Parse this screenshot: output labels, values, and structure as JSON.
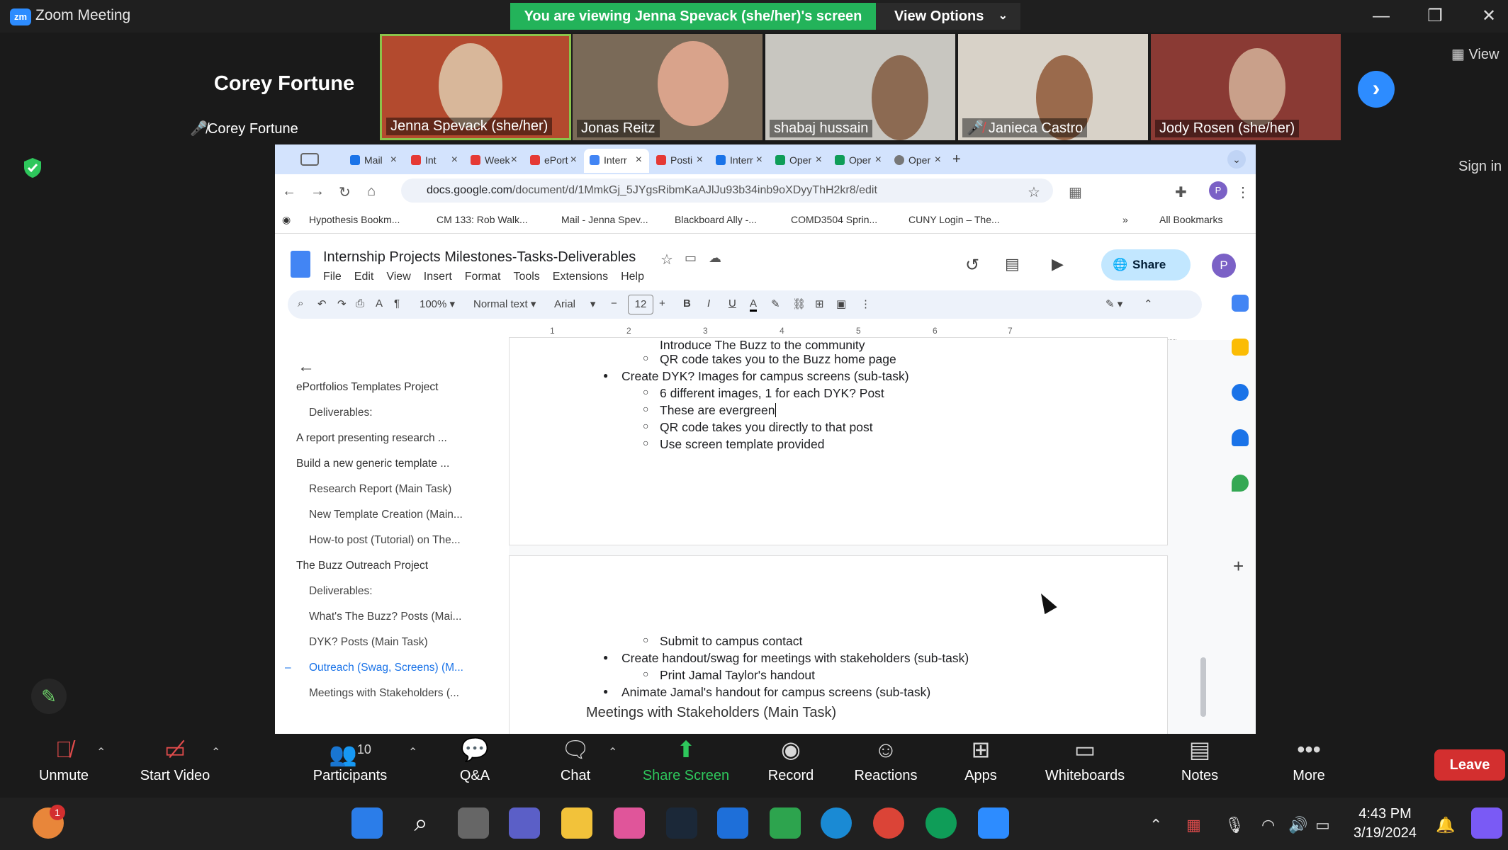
{
  "window": {
    "title": "Zoom Meeting",
    "logo": "zm"
  },
  "banner": {
    "viewing": "You are viewing Jenna Spevack (she/her)'s screen",
    "view_options": "View Options"
  },
  "gallery": {
    "active_speaker": "Corey Fortune",
    "tiles": [
      {
        "name": "Corey Fortune",
        "muted": true
      },
      {
        "name": "Jenna Spevack (she/her)",
        "muted": false
      },
      {
        "name": "Jonas Reitz",
        "muted": false
      },
      {
        "name": "shabaj hussain",
        "muted": false
      },
      {
        "name": "Janieca Castro",
        "muted": true
      },
      {
        "name": "Jody Rosen (she/her)",
        "muted": false
      }
    ],
    "view_label": "View"
  },
  "signin": "Sign in",
  "browser": {
    "tabs": [
      "Mail",
      "Int",
      "Week",
      "ePort",
      "Interr",
      "Posti",
      "Interr",
      "Oper",
      "Oper",
      "Oper"
    ],
    "url_domain": "docs.google.com",
    "url_path": "/document/d/1MmkGj_5JYgsRibmKaAJlJu93b34inb9oXDyyThH2kr8/edit",
    "bookmarks": [
      "Hypothesis Bookm...",
      "CM 133: Rob Walk...",
      "Mail - Jenna Spev...",
      "Blackboard Ally -...",
      "COMD3504 Sprin...",
      "CUNY Login – The...",
      "All Bookmarks"
    ]
  },
  "doc": {
    "title": "Internship Projects Milestones-Tasks-Deliverables",
    "menu": [
      "File",
      "Edit",
      "View",
      "Insert",
      "Format",
      "Tools",
      "Extensions",
      "Help"
    ],
    "share": "Share",
    "avatar": "P",
    "toolbar": {
      "zoom": "100%",
      "style": "Normal text",
      "font": "Arial",
      "size": "12"
    },
    "ruler": [
      "1",
      "2",
      "3",
      "4",
      "5",
      "6",
      "7"
    ],
    "outline": [
      {
        "text": "ePortfolios Templates Project",
        "level": 1
      },
      {
        "text": "Deliverables:",
        "level": 2
      },
      {
        "text": "A report presenting research ...",
        "level": 1
      },
      {
        "text": "Build a new generic template ...",
        "level": 1
      },
      {
        "text": "Research Report (Main Task)",
        "level": 2
      },
      {
        "text": "New Template Creation (Main...",
        "level": 2
      },
      {
        "text": "How-to post (Tutorial) on The...",
        "level": 2
      },
      {
        "text": "The Buzz Outreach Project",
        "level": 1
      },
      {
        "text": "Deliverables:",
        "level": 2
      },
      {
        "text": "What's The Buzz? Posts (Mai...",
        "level": 2
      },
      {
        "text": "DYK? Posts (Main Task)",
        "level": 2
      },
      {
        "text": "Outreach (Swag, Screens) (M...",
        "level": 2,
        "active": true
      },
      {
        "text": "Meetings with Stakeholders (...",
        "level": 2
      }
    ],
    "page1": [
      {
        "t": "Introduce The Buzz to the community",
        "lvl": 2
      },
      {
        "t": "QR code takes you to the Buzz home page",
        "lvl": 2
      },
      {
        "t": "Create DYK? Images for campus screens (sub-task)",
        "lvl": 1
      },
      {
        "t": "6 different images, 1 for each DYK? Post",
        "lvl": 2
      },
      {
        "t": "These are evergreen",
        "lvl": 2
      },
      {
        "t": "QR code takes you directly to that post",
        "lvl": 2
      },
      {
        "t": "Use screen template provided",
        "lvl": 2
      }
    ],
    "page2": [
      {
        "t": "Submit to campus contact",
        "lvl": 2
      },
      {
        "t": "Create handout/swag for meetings with stakeholders (sub-task)",
        "lvl": 1
      },
      {
        "t": "Print Jamal Taylor's handout",
        "lvl": 2
      },
      {
        "t": "Animate Jamal's handout for campus screens (sub-task)",
        "lvl": 1
      }
    ],
    "heading": "Meetings with Stakeholders (Main Task)"
  },
  "zoombar": {
    "unmute": "Unmute",
    "video": "Start Video",
    "participants": "Participants",
    "participants_count": "10",
    "qa": "Q&A",
    "chat": "Chat",
    "share": "Share Screen",
    "record": "Record",
    "reactions": "Reactions",
    "apps": "Apps",
    "whiteboards": "Whiteboards",
    "notes": "Notes",
    "more": "More",
    "leave": "Leave"
  },
  "taskbar": {
    "time": "4:43 PM",
    "date": "3/19/2024",
    "badge": "1"
  },
  "colors": {
    "zoom_blue": "#2d8cff",
    "share_green": "#23b35a",
    "leave_red": "#d32f2f"
  }
}
